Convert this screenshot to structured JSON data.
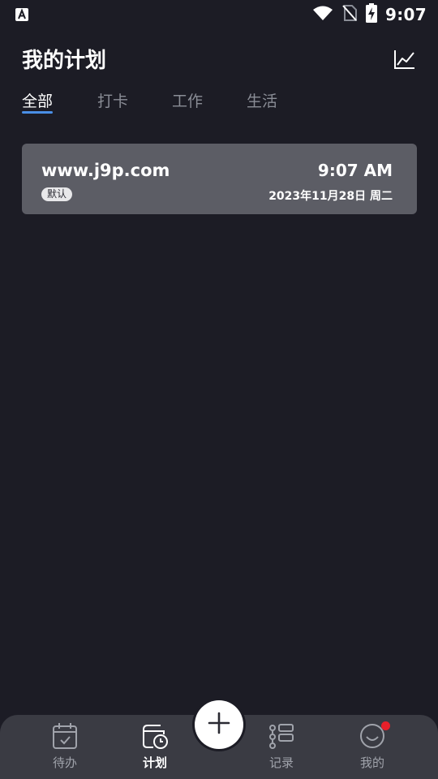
{
  "status_bar": {
    "time": "9:07",
    "icons": [
      "app-notification-icon",
      "wifi-icon",
      "no-sim-icon",
      "battery-charging-icon"
    ]
  },
  "header": {
    "title": "我的计划",
    "stats_icon": "line-chart-icon"
  },
  "tabs": [
    {
      "label": "全部",
      "active": true
    },
    {
      "label": "打卡",
      "active": false
    },
    {
      "label": "工作",
      "active": false
    },
    {
      "label": "生活",
      "active": false
    }
  ],
  "plans": [
    {
      "title": "www.j9p.com",
      "tag": "默认",
      "time": "9:07 AM",
      "date": "2023年11月28日 周二"
    }
  ],
  "bottom_nav": {
    "items": [
      {
        "label": "待办",
        "icon": "calendar-check-icon",
        "active": false
      },
      {
        "label": "计划",
        "icon": "plan-clock-icon",
        "active": true
      },
      {
        "label": "记录",
        "icon": "list-icon",
        "active": false
      },
      {
        "label": "我的",
        "icon": "smiley-icon",
        "active": false
      }
    ],
    "add_icon": "plus-icon"
  },
  "colors": {
    "background": "#1c1c25",
    "card": "#5c5d65",
    "nav": "#3a3b43",
    "accent": "#4a8fe6",
    "badge": "#e8202a"
  }
}
